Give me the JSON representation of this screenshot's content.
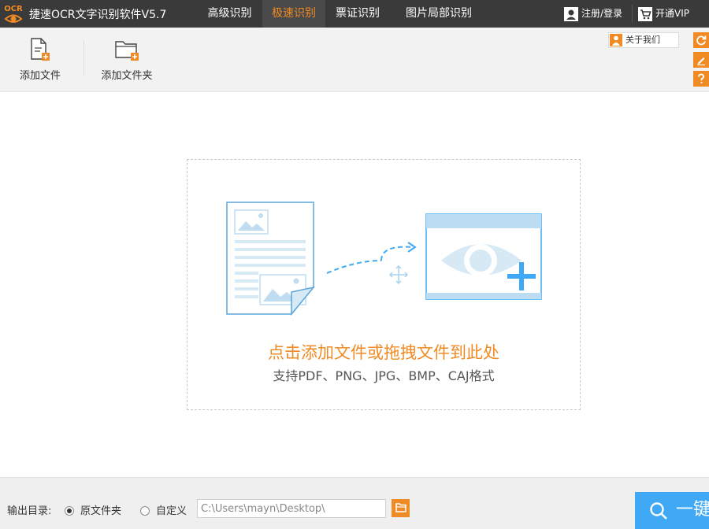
{
  "app": {
    "title": "捷速OCR文字识别软件V5.7",
    "logo_text": "OCR"
  },
  "nav": {
    "tabs": [
      {
        "label": "高级识别",
        "active": false
      },
      {
        "label": "极速识别",
        "active": true
      },
      {
        "label": "票证识别",
        "active": false
      },
      {
        "label": "图片局部识别",
        "active": false
      }
    ],
    "login_label": "注册/登录",
    "vip_label": "开通VIP"
  },
  "toolbar": {
    "add_file_label": "添加文件",
    "add_folder_label": "添加文件夹",
    "about_label": "关于我们"
  },
  "drop": {
    "title": "点击添加文件或拖拽文件到此处",
    "subtitle": "支持PDF、PNG、JPG、BMP、CAJ格式"
  },
  "bottom": {
    "output_label": "输出目录:",
    "option_original": "原文件夹",
    "option_custom": "自定义",
    "selected_option": "原文件夹",
    "path_value": "C:\\Users\\mayn\\Desktop\\",
    "start_label": "一键"
  },
  "colors": {
    "accent": "#f08a24",
    "primary": "#3fa9f5",
    "titlebar": "#3a3a3a"
  },
  "icons": [
    "ocr-logo-icon",
    "user-icon",
    "cart-icon",
    "add-file-icon",
    "add-folder-icon",
    "about-icon",
    "refresh-icon",
    "edit-icon",
    "help-icon",
    "document-icon",
    "arrow-icon",
    "move-icon",
    "eye-preview-icon",
    "folder-icon",
    "search-icon"
  ]
}
